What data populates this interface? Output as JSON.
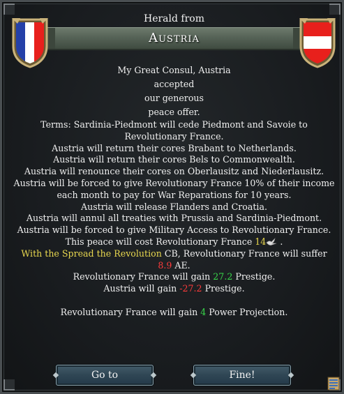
{
  "header": {
    "herald_label": "Herald from",
    "country": "Austria"
  },
  "flags": {
    "left": {
      "name": "france-flag-icon",
      "colors": [
        "#2440a8",
        "#ffffff",
        "#e8201c"
      ]
    },
    "right": {
      "name": "austria-flag-icon",
      "colors": [
        "#e8201c",
        "#ffffff",
        "#e8201c"
      ]
    }
  },
  "message": {
    "intro": [
      "My Great Consul, Austria",
      "accepted",
      "our generous",
      "peace offer."
    ],
    "terms": [
      "Terms: Sardinia-Piedmont will cede Piedmont and Savoie to Revolutionary France.",
      "Austria will return their cores Brabant to Netherlands.",
      "Austria will return their cores Bels to Commonwealth.",
      "Austria will renounce their cores on Oberlausitz and Niederlausitz.",
      "Austria will be forced to give Revolutionary France 10% of their income each month to pay for War Reparations for 10 years.",
      "Austria will release Flanders and Croatia.",
      "Austria will annul all treaties with Prussia and Sardinia-Piedmont.",
      "Austria will be forced to give Military Access to Revolutionary France."
    ],
    "cost_prefix": "This peace will cost Revolutionary France ",
    "cost_value": "14",
    "cost_suffix": " .",
    "cb_prefix": "With the ",
    "cb_name": "Spread the Revolution",
    "cb_middle": " CB, Revolutionary France will suffer ",
    "ae_value": "8.9",
    "ae_suffix": " AE.",
    "prestige_gain_prefix": "Revolutionary France will gain ",
    "prestige_gain_value": "27.2",
    "prestige_gain_suffix": " Prestige.",
    "prestige_loss_prefix": "Austria will gain ",
    "prestige_loss_value": "-27.2",
    "prestige_loss_suffix": " Prestige.",
    "pp_prefix": "Revolutionary France will gain ",
    "pp_value": "4",
    "pp_suffix": " Power Projection."
  },
  "buttons": {
    "goto_label": "Go to",
    "fine_label": "Fine!"
  },
  "colors": {
    "highlight_yellow": "#e8d74f",
    "negative_red": "#ff3b3b",
    "positive_green": "#38d84a"
  },
  "icons": {
    "dove": "dove-icon",
    "ledger": "ledger-icon"
  }
}
